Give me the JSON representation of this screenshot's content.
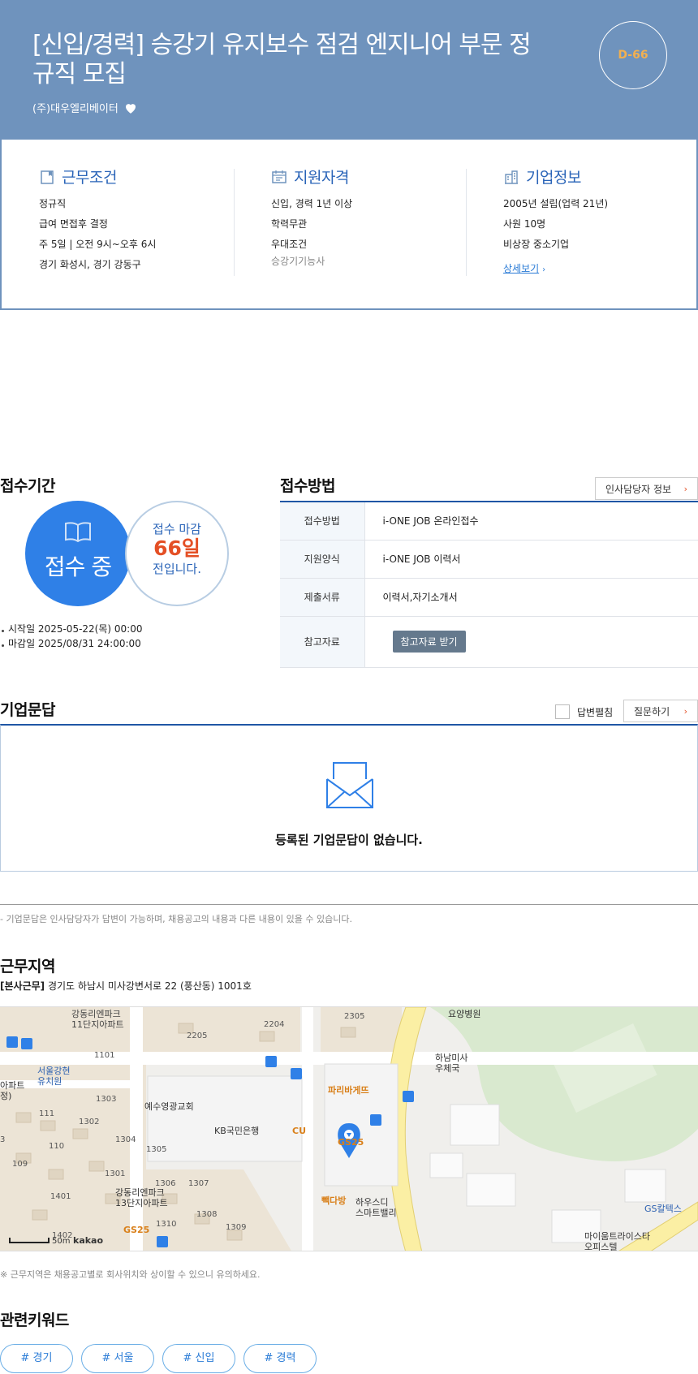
{
  "header": {
    "title": "[신입/경력] 승강기 유지보수 점검 엔지니어 부문 정규직 모집",
    "company": "(주)대우엘리베이터",
    "dday": "D-66"
  },
  "summary": {
    "work": {
      "title": "근무조건",
      "lines": [
        "정규직",
        "급여 면접후 결정",
        "주 5일 | 오전 9시~오후 6시",
        "경기 화성시, 경기 강동구"
      ]
    },
    "qualification": {
      "title": "지원자격",
      "lines": [
        "신입, 경력 1년 이상",
        "학력무관",
        "우대조건"
      ],
      "preferred": "승강기기능사"
    },
    "company_info": {
      "title": "기업정보",
      "lines": [
        "2005년 설립(업력 21년)",
        "사원 10명",
        "비상장 중소기업"
      ],
      "detail_link": "상세보기"
    }
  },
  "period": {
    "title": "접수기간",
    "status": "접수 중",
    "deadline_label": "접수 마감",
    "days_left": "66일",
    "days_suffix": "전입니다.",
    "start": "시작일 2025-05-22(목) 00:00",
    "end": "마감일 2025/08/31 24:00:00"
  },
  "method": {
    "title": "접수방법",
    "hr_button": "인사담당자 정보",
    "rows": [
      {
        "key": "접수방법",
        "value": "i-ONE JOB 온라인접수"
      },
      {
        "key": "지원양식",
        "value": "i-ONE JOB 이력서"
      },
      {
        "key": "제출서류",
        "value": "이력서,자기소개서"
      },
      {
        "key": "참고자료",
        "value": ""
      }
    ],
    "ref_button": "참고자료 받기"
  },
  "qa": {
    "title": "기업문답",
    "answer_toggle": "답변펼침",
    "ask_button": "질문하기",
    "empty_text": "등록된 기업문답이 없습니다.",
    "note": "- 기업문답은 인사담당자가 답변이 가능하며, 채용공고의 내용과 다른 내용이 있을 수 있습니다."
  },
  "location": {
    "title": "근무지역",
    "tag": "[본사근무]",
    "address": "경기도 하남시 미사강변서로 22 (풍산동) 1001호",
    "map_labels": {
      "apt11": "강동리엔파크\n11단지아파트",
      "kinder": "서울강현\n유치원",
      "apt_left": "아파트\n정)",
      "church": "예수영광교회",
      "kb": "KB국민은행",
      "cu": "CU",
      "paris": "파리바게뜨",
      "gs25": "GS25",
      "gs25b": "GS25",
      "post": "하남미사\n우체국",
      "hospital": "요양병원",
      "ppak": "빽다방",
      "house": "하우스디\n스마트밸리",
      "apt13": "강동리엔파크\n13단지아파트",
      "gscaltex": "GS칼텍스",
      "mi": "마이움트라이스타\n오피스텔",
      "scale": "50m",
      "kakao": "kakao"
    },
    "map_numbers": [
      "2205",
      "2204",
      "2305",
      "1101",
      "1303",
      "111",
      "1302",
      "110",
      "1304",
      "1305",
      "109",
      "1301",
      "1306",
      "1307",
      "1401",
      "1308",
      "1310",
      "1309",
      "1402",
      "3"
    ],
    "note": "※ 근무지역은 채용공고별로 회사위치와 상이할 수 있으니 유의하세요."
  },
  "keywords": {
    "title": "관련키워드",
    "items": [
      "# 경기",
      "# 서울",
      "# 신입",
      "# 경력"
    ]
  },
  "colors": {
    "hero_bg": "#6f93bd",
    "accent_blue": "#2f80e7",
    "deadline_orange": "#e44f25",
    "dday_orange": "#f3b04f"
  }
}
